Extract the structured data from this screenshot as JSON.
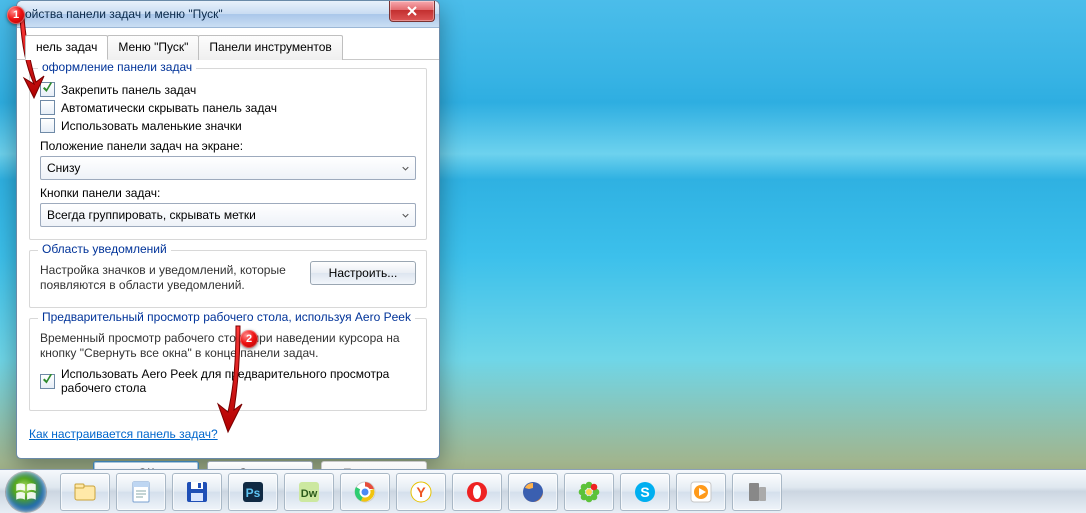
{
  "window": {
    "title": "ойства панели задач и меню \"Пуск\""
  },
  "tabs": [
    {
      "id": "taskbar",
      "label": "нель задач"
    },
    {
      "id": "startmenu",
      "label": "Меню \"Пуск\""
    },
    {
      "id": "toolbars",
      "label": "Панели инструментов"
    }
  ],
  "group_design": {
    "legend": "оформление панели задач",
    "lock": "Закрепить панель задач",
    "autohide": "Автоматически скрывать панель задач",
    "small_icons": "Использовать маленькие значки",
    "position_label": "Положение панели задач на экране:",
    "position_value": "Снизу",
    "buttons_label": "Кнопки панели задач:",
    "buttons_value": "Всегда группировать, скрывать метки"
  },
  "group_notify": {
    "legend": "Область уведомлений",
    "desc": "Настройка значков и уведомлений, которые появляются в области уведомлений.",
    "configure": "Настроить..."
  },
  "group_peek": {
    "legend": "Предварительный просмотр рабочего стола, используя Aero Peek",
    "desc": "Временный просмотр рабочего стола при наведении курсора на кнопку \"Свернуть все окна\" в конце панели задач.",
    "use_peek": "Использовать Aero Peek для предварительного просмотра рабочего стола"
  },
  "link": "Как настраивается панель задач?",
  "footer": {
    "ok": "ОК",
    "cancel": "Отмена",
    "apply": "Применить"
  },
  "markers": {
    "m1": "1",
    "m2": "2"
  },
  "taskbar_apps": [
    {
      "name": "explorer",
      "color": "#f7d27a"
    },
    {
      "name": "notepad",
      "color": "#bed6f2"
    },
    {
      "name": "save",
      "color": "#1f4fb6"
    },
    {
      "name": "photoshop",
      "color": "#102a44"
    },
    {
      "name": "dreamweaver",
      "color": "#c8e28a"
    },
    {
      "name": "chrome",
      "color": "#fff"
    },
    {
      "name": "yandex",
      "color": "#ffdc3a"
    },
    {
      "name": "opera",
      "color": "#e22"
    },
    {
      "name": "firefox",
      "color": "#ff8a1a"
    },
    {
      "name": "icq",
      "color": "#5cc23a"
    },
    {
      "name": "skype",
      "color": "#00aff0"
    },
    {
      "name": "media",
      "color": "#ff9a1a"
    },
    {
      "name": "gray-app",
      "color": "#888"
    }
  ]
}
